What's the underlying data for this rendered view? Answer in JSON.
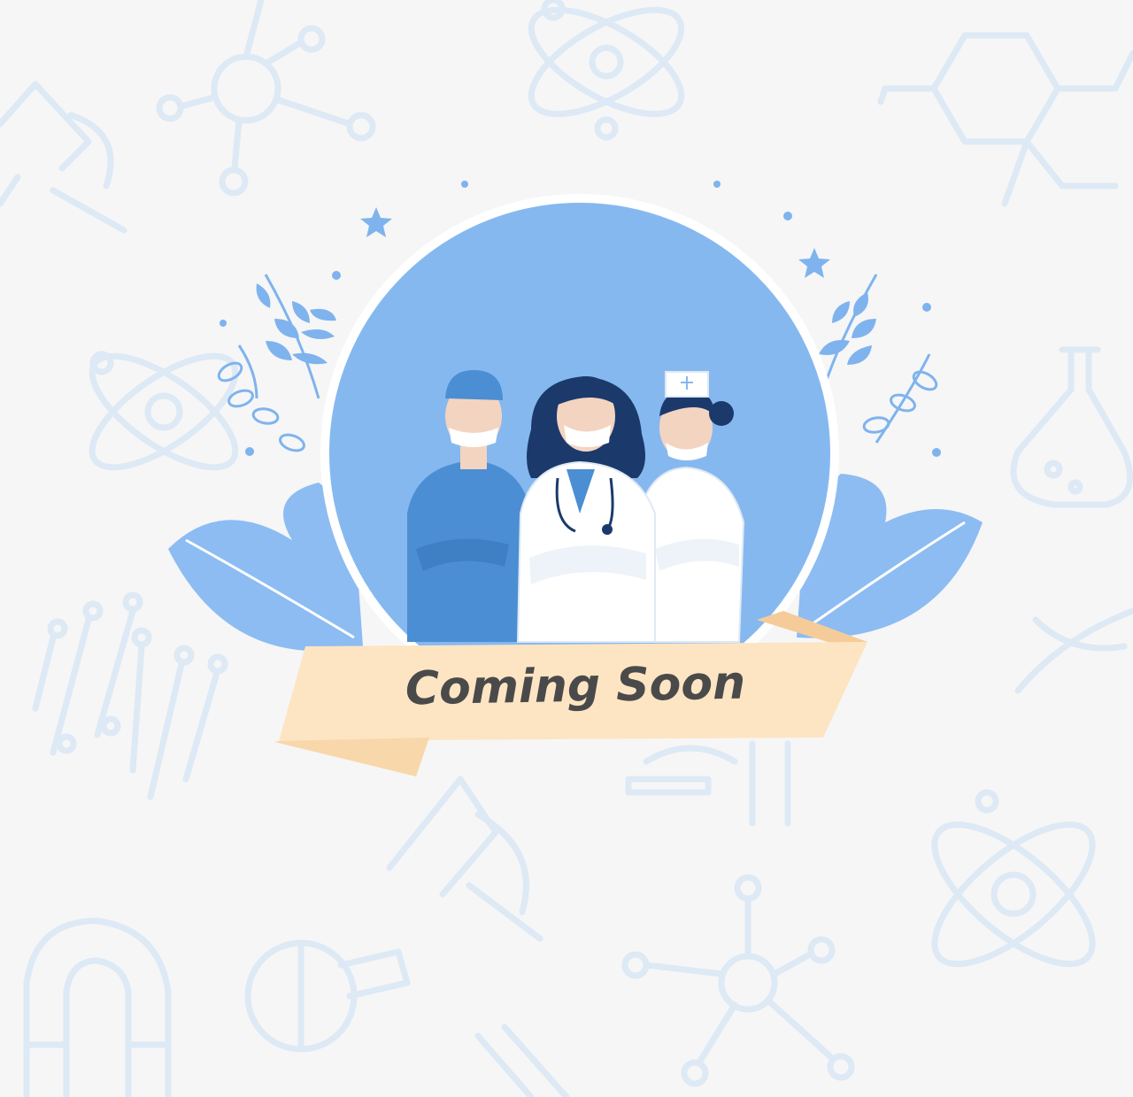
{
  "banner": {
    "text": "Coming Soon"
  },
  "background": {
    "pattern_icons": [
      "atom-icon",
      "molecule-icon",
      "microscope-icon",
      "flask-icon",
      "magnet-icon",
      "circuit-icon",
      "dna-icon",
      "chemical-structure-icon"
    ]
  },
  "illustration": {
    "characters": [
      "surgeon",
      "doctor",
      "nurse"
    ]
  },
  "colors": {
    "background": "#f6f6f6",
    "circle": "#86b8f0",
    "pattern": "#dde9f4",
    "leaf": "#8cbcf2",
    "banner": "#fde5c3",
    "banner_fold": "#f5cc99",
    "text": "#4a4a4a"
  }
}
